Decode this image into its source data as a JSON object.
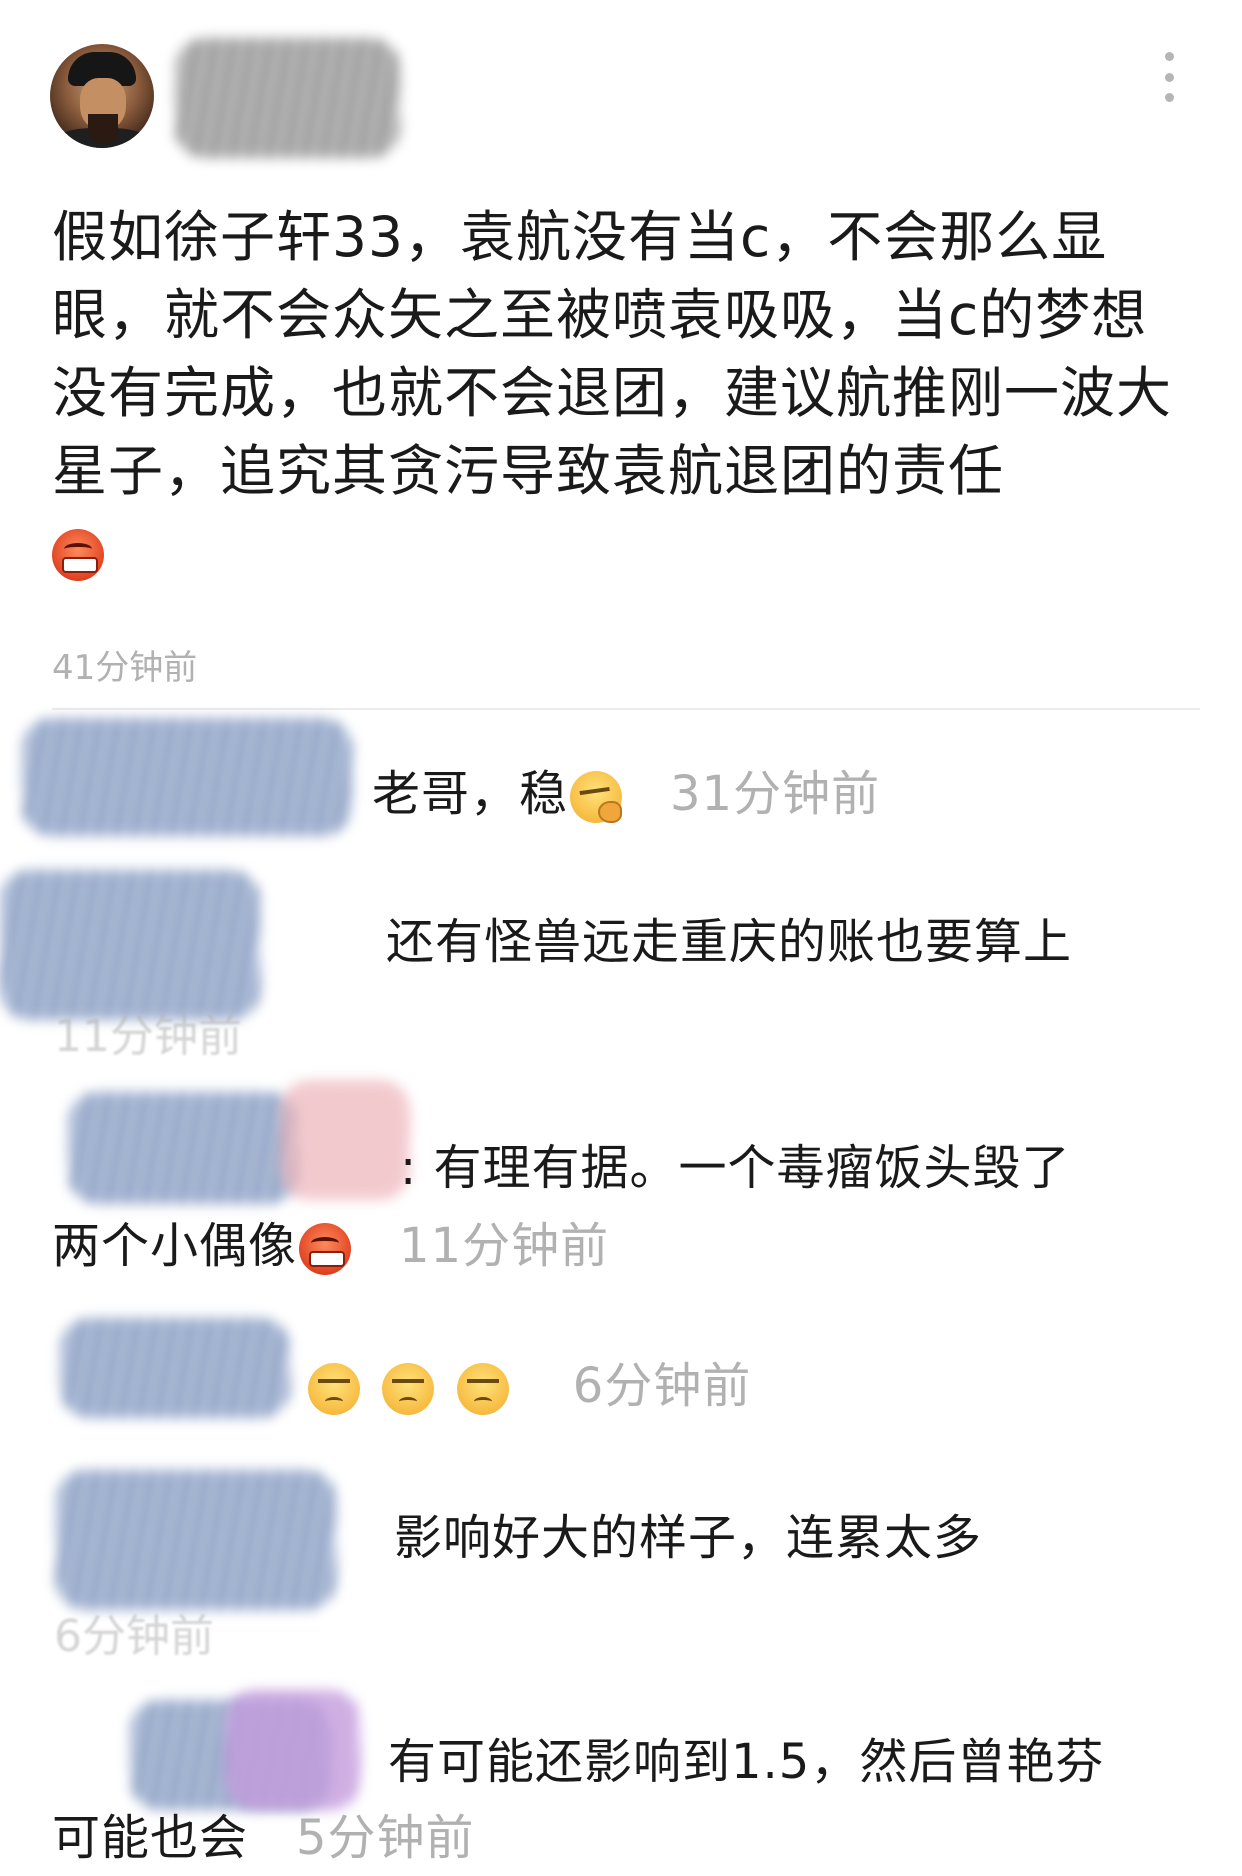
{
  "post": {
    "text": "假如徐子轩33，袁航没有当c，不会那么显眼，就不会众矢之至被喷袁吸吸，当c的梦想没有完成，也就不会退团，建议航推刚一波大星子，追究其贪污导致袁航退团的责任",
    "emoji": "angry-face-icon",
    "time": "41分钟前"
  },
  "replies": [
    {
      "text": "老哥，稳",
      "emoji": "thinking-face-icon",
      "time": "31分钟前"
    },
    {
      "text": "还有怪兽远走重庆的账也要算上",
      "time": "11分钟前"
    },
    {
      "text": "有理有据。一个毒瘤饭头毁了",
      "text2": "两个小偶像",
      "emoji": "angry-face-icon",
      "time": "11分钟前"
    },
    {
      "text": "",
      "emoji": "unamused-face-icon",
      "emoji_count": 3,
      "time": "6分钟前"
    },
    {
      "text": "影响好大的样子，连累太多",
      "time": "6分钟前"
    },
    {
      "text": "有可能还影响到1.5，然后曾艳芬",
      "text2": "可能也会",
      "time": "5分钟前"
    }
  ],
  "colors": {
    "text": "#1a1a1a",
    "time": "#b1b1b1",
    "divider": "#ececec"
  }
}
